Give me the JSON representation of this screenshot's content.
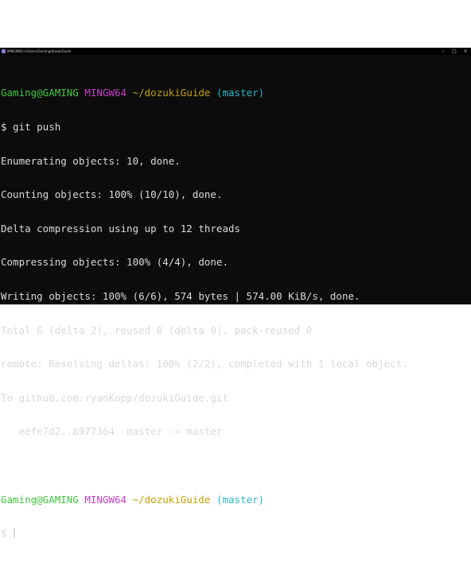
{
  "window": {
    "title": "MINGW64:/c/Users/Gaming/dozukiGuide"
  },
  "colors": {
    "background": "#0c0c0c",
    "text": "#d9d9d9",
    "user_host": "#3ec83e",
    "mingw": "#c43dc4",
    "path": "#c2a000",
    "branch": "#2ab7c8"
  },
  "prompt1": {
    "user_host": "Gaming@GAMING",
    "env": "MINGW64",
    "path": "~/dozukiGuide",
    "branch": "(master)"
  },
  "command": "$ git push",
  "output": [
    "Enumerating objects: 10, done.",
    "Counting objects: 100% (10/10), done.",
    "Delta compression using up to 12 threads",
    "Compressing objects: 100% (4/4), done.",
    "Writing objects: 100% (6/6), 574 bytes | 574.00 KiB/s, done.",
    "Total 6 (delta 2), reused 0 (delta 0), pack-reused 0",
    "remote: Resolving deltas: 100% (2/2), completed with 1 local object.",
    "To github.com:ryanKopp/dozukiGuide.git",
    "   eefe7d2..b977364  master -> master"
  ],
  "prompt2": {
    "user_host": "Gaming@GAMING",
    "env": "MINGW64",
    "path": "~/dozukiGuide",
    "branch": "(master)"
  },
  "input_prompt": "$ "
}
